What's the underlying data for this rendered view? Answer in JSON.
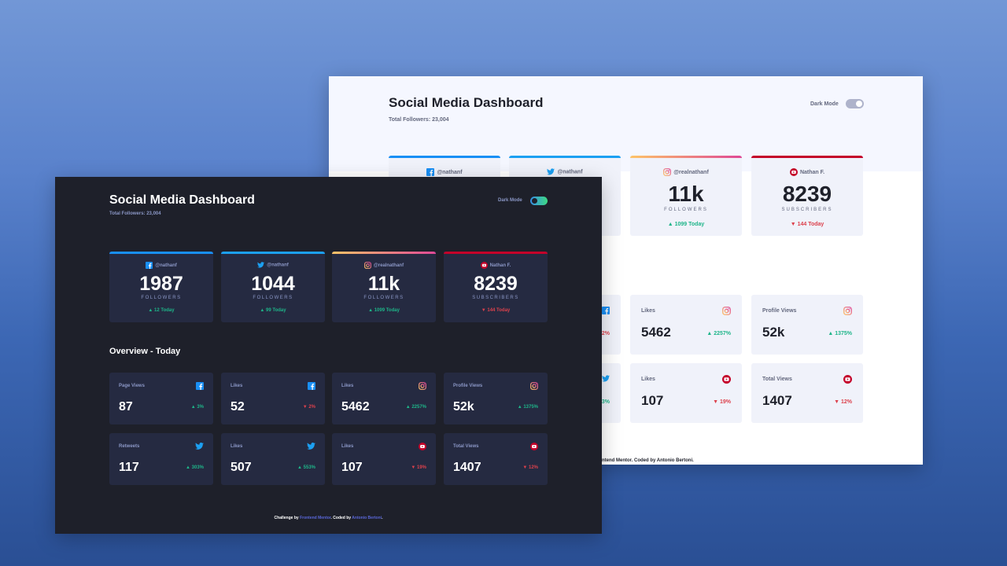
{
  "colors": {
    "facebook": "#198ff5",
    "twitter": "#1ca0f2",
    "instagram_start": "#fdc468",
    "instagram_end": "#df4996",
    "youtube": "#c4032a",
    "up": "#1eb589",
    "down": "#dc414c",
    "dark_bg": "#1e202a",
    "dark_card": "#252a41",
    "light_card": "#f0f2fa",
    "toggle_on": "#3eda82"
  },
  "light": {
    "title": "Social Media Dashboard",
    "total_followers": "Total Followers: 23,004",
    "dark_mode_label": "Dark Mode",
    "cards": [
      {
        "handle": "@nathanf",
        "icon": "facebook-icon"
      },
      {
        "handle": "@nathanf",
        "icon": "twitter-icon"
      },
      {
        "handle": "@realnathanf",
        "icon": "instagram-icon",
        "count": "11k",
        "unit": "FOLLOWERS",
        "today": "1099 Today",
        "trend": "up"
      },
      {
        "handle": "Nathan F.",
        "icon": "youtube-icon",
        "count": "8239",
        "unit": "SUBSCRIBERS",
        "today": "144 Today",
        "trend": "down"
      }
    ],
    "overview_partial": [
      {
        "pct": "2%",
        "trend": "down",
        "icon": "facebook-icon"
      },
      {
        "pct": "3%",
        "trend": "up",
        "icon": "twitter-icon"
      }
    ],
    "overview": [
      {
        "label": "Likes",
        "value": "5462",
        "pct": "2257%",
        "trend": "up",
        "icon": "instagram-icon"
      },
      {
        "label": "Profile Views",
        "value": "52k",
        "pct": "1375%",
        "trend": "up",
        "icon": "instagram-icon"
      },
      {
        "label": "Likes",
        "value": "107",
        "pct": "19%",
        "trend": "down",
        "icon": "youtube-icon"
      },
      {
        "label": "Total Views",
        "value": "1407",
        "pct": "12%",
        "trend": "down",
        "icon": "youtube-icon"
      }
    ],
    "footer": {
      "partial": "ntend Mentor. Coded by ",
      "author": "Antonio Bertoni",
      "end": "."
    }
  },
  "dark": {
    "title": "Social Media Dashboard",
    "total_followers": "Total Followers: 23,004",
    "dark_mode_label": "Dark Mode",
    "cards": [
      {
        "handle": "@nathanf",
        "icon": "facebook-icon",
        "count": "1987",
        "unit": "FOLLOWERS",
        "today": "12 Today",
        "trend": "up"
      },
      {
        "handle": "@nathanf",
        "icon": "twitter-icon",
        "count": "1044",
        "unit": "FOLLOWERS",
        "today": "99 Today",
        "trend": "up"
      },
      {
        "handle": "@realnathanf",
        "icon": "instagram-icon",
        "count": "11k",
        "unit": "FOLLOWERS",
        "today": "1099 Today",
        "trend": "up"
      },
      {
        "handle": "Nathan F.",
        "icon": "youtube-icon",
        "count": "8239",
        "unit": "SUBSCRIBERS",
        "today": "144 Today",
        "trend": "down"
      }
    ],
    "overview_title": "Overview - Today",
    "overview": [
      {
        "label": "Page Views",
        "value": "87",
        "pct": "3%",
        "trend": "up",
        "icon": "facebook-icon"
      },
      {
        "label": "Likes",
        "value": "52",
        "pct": "2%",
        "trend": "down",
        "icon": "facebook-icon"
      },
      {
        "label": "Likes",
        "value": "5462",
        "pct": "2257%",
        "trend": "up",
        "icon": "instagram-icon"
      },
      {
        "label": "Profile Views",
        "value": "52k",
        "pct": "1375%",
        "trend": "up",
        "icon": "instagram-icon"
      },
      {
        "label": "Retweets",
        "value": "117",
        "pct": "303%",
        "trend": "up",
        "icon": "twitter-icon"
      },
      {
        "label": "Likes",
        "value": "507",
        "pct": "553%",
        "trend": "up",
        "icon": "twitter-icon"
      },
      {
        "label": "Likes",
        "value": "107",
        "pct": "19%",
        "trend": "down",
        "icon": "youtube-icon"
      },
      {
        "label": "Total Views",
        "value": "1407",
        "pct": "12%",
        "trend": "down",
        "icon": "youtube-icon"
      }
    ],
    "footer": {
      "prefix": "Challenge by ",
      "org": "Frontend Mentor",
      "mid": ". Coded by ",
      "author": "Antonio Bertoni",
      "end": "."
    }
  }
}
